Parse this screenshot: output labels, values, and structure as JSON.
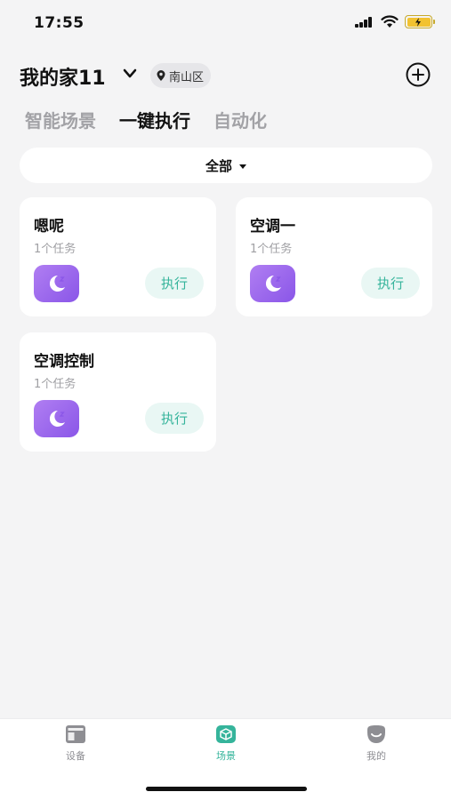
{
  "status_bar": {
    "time": "17:55"
  },
  "header": {
    "home_name": "我的家11",
    "location": "南山区"
  },
  "tabs": [
    {
      "label": "智能场景",
      "active": false
    },
    {
      "label": "一键执行",
      "active": true
    },
    {
      "label": "自动化",
      "active": false
    }
  ],
  "filter": {
    "label": "全部"
  },
  "scenes": [
    {
      "name": "嗯呢",
      "tasks": "1个任务",
      "icon": "moon-sleep-icon",
      "action": "执行"
    },
    {
      "name": "空调一",
      "tasks": "1个任务",
      "icon": "moon-sleep-icon",
      "action": "执行"
    },
    {
      "name": "空调控制",
      "tasks": "1个任务",
      "icon": "moon-sleep-icon",
      "action": "执行"
    }
  ],
  "bottom_nav": [
    {
      "label": "设备",
      "icon": "device-grid-icon",
      "active": false
    },
    {
      "label": "场景",
      "icon": "scene-cube-icon",
      "active": true
    },
    {
      "label": "我的",
      "icon": "profile-icon",
      "active": false
    }
  ],
  "colors": {
    "accent": "#35b49b",
    "scene_icon": "#9b6bef",
    "battery": "#f2c230"
  }
}
